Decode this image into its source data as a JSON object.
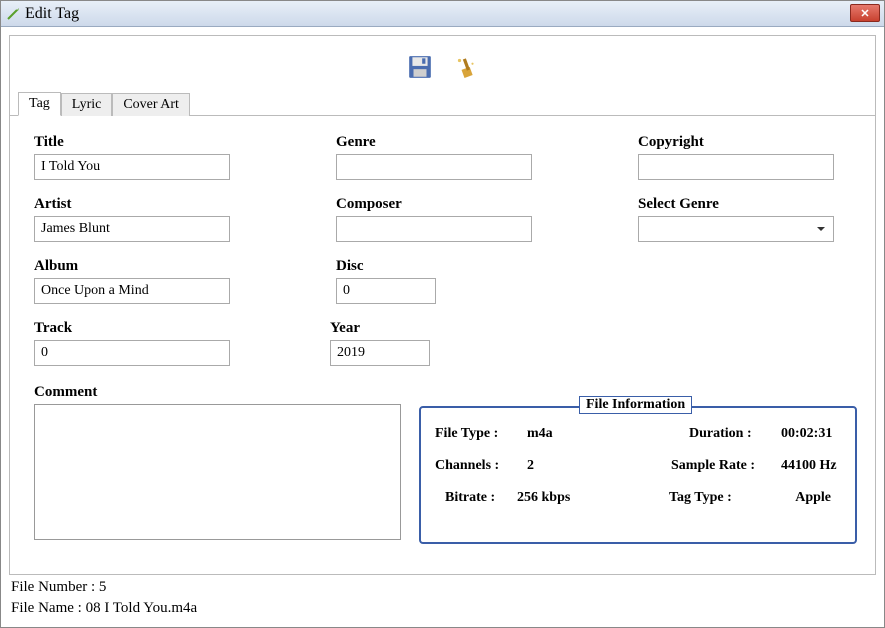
{
  "window": {
    "title": "Edit Tag"
  },
  "tabs": [
    {
      "label": "Tag",
      "active": true
    },
    {
      "label": "Lyric",
      "active": false
    },
    {
      "label": "Cover Art",
      "active": false
    }
  ],
  "fields": {
    "title": {
      "label": "Title",
      "value": "I Told You"
    },
    "genre": {
      "label": "Genre",
      "value": ""
    },
    "copyright": {
      "label": "Copyright",
      "value": ""
    },
    "artist": {
      "label": "Artist",
      "value": "James Blunt"
    },
    "composer": {
      "label": "Composer",
      "value": ""
    },
    "select_genre": {
      "label": "Select Genre",
      "value": ""
    },
    "album": {
      "label": "Album",
      "value": "Once Upon a Mind"
    },
    "disc": {
      "label": "Disc",
      "value": "0"
    },
    "track": {
      "label": "Track",
      "value": "0"
    },
    "year": {
      "label": "Year",
      "value": "2019"
    },
    "comment": {
      "label": "Comment",
      "value": ""
    }
  },
  "file_info": {
    "legend": "File Information",
    "file_type_label": "File Type :",
    "file_type": "m4a",
    "duration_label": "Duration :",
    "duration": "00:02:31",
    "channels_label": "Channels :",
    "channels": "2",
    "sample_rate_label": "Sample Rate :",
    "sample_rate": "44100 Hz",
    "bitrate_label": "Bitrate :",
    "bitrate": "256 kbps",
    "tag_type_label": "Tag Type :",
    "tag_type": "Apple"
  },
  "status": {
    "file_number_label": "File Number : ",
    "file_number": "5",
    "file_name_label": "File Name : ",
    "file_name": "08 I Told You.m4a"
  }
}
